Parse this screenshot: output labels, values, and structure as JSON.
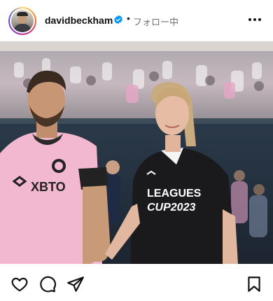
{
  "post": {
    "username": "davidbeckham",
    "verified": true,
    "separator": "•",
    "follow_status": "フォロー中",
    "more_icon": "more-horizontal-icon"
  },
  "photo": {
    "jersey_left_text": "XBTO",
    "jersey_right_line1": "LEAGUES",
    "jersey_right_line2": "CUP2023"
  },
  "actions": {
    "icons": [
      "heart-icon",
      "comment-icon",
      "share-icon",
      "bookmark-icon"
    ]
  },
  "colors": {
    "verified_blue": "#0095f6",
    "pink_jersey": "#f2b8cf",
    "black_jersey": "#1a1a1c"
  }
}
